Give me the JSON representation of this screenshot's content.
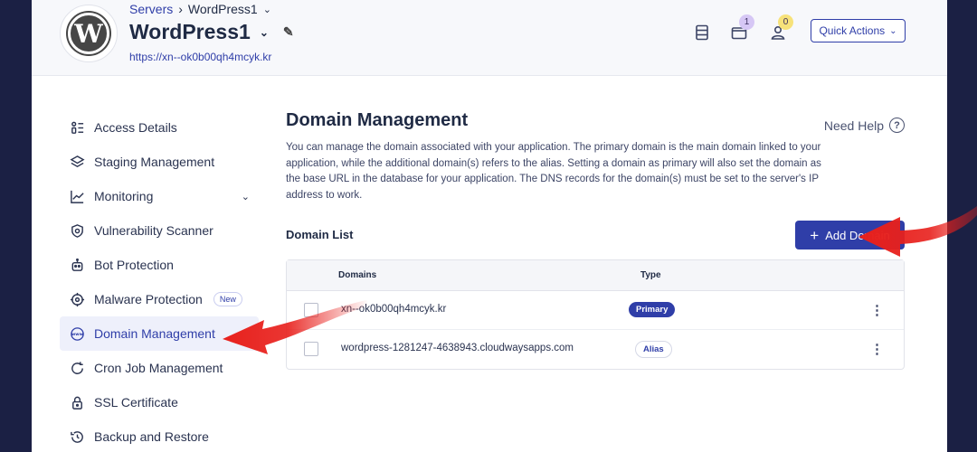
{
  "header": {
    "breadcrumb_parent": "Servers",
    "breadcrumb_current": "WordPress1",
    "app_title": "WordPress1",
    "app_url": "https://xn--ok0b00qh4mcyk.kr",
    "projects_badge": "1",
    "members_badge": "0",
    "quick_actions_label": "Quick Actions",
    "logo_letter": "W"
  },
  "sidebar": {
    "items": [
      {
        "label": "Access Details",
        "icon": "access-details-icon"
      },
      {
        "label": "Staging Management",
        "icon": "layers-icon"
      },
      {
        "label": "Monitoring",
        "icon": "chart-line-icon"
      },
      {
        "label": "Vulnerability Scanner",
        "icon": "shield-scan-icon"
      },
      {
        "label": "Bot Protection",
        "icon": "robot-icon"
      },
      {
        "label": "Malware Protection",
        "icon": "crosshair-icon",
        "badge": "New"
      },
      {
        "label": "Domain Management",
        "icon": "www-icon",
        "active": true
      },
      {
        "label": "Cron Job Management",
        "icon": "refresh-icon"
      },
      {
        "label": "SSL Certificate",
        "icon": "lock-icon"
      },
      {
        "label": "Backup and Restore",
        "icon": "restore-icon"
      }
    ]
  },
  "main": {
    "title": "Domain Management",
    "need_help": "Need Help",
    "description": "You can manage the domain associated with your application. The primary domain is the main domain linked to your application, while the additional domain(s) refers to the alias. Setting a domain as primary will also set the domain as the base URL in the database for your application. The DNS records for the domain(s) must be set to the server's IP address to work.",
    "domain_list_title": "Domain List",
    "add_domain_label": "Add Domain",
    "table": {
      "headers": [
        "Domains",
        "Type"
      ],
      "rows": [
        {
          "domain": "xn--ok0b00qh4mcyk.kr",
          "type": "Primary"
        },
        {
          "domain": "wordpress-1281247-4638943.cloudwaysapps.com",
          "type": "Alias"
        }
      ]
    }
  },
  "colors": {
    "accent": "#2f3ea8",
    "annotation_arrow": "#e8201c",
    "frame": "#1b2044"
  }
}
